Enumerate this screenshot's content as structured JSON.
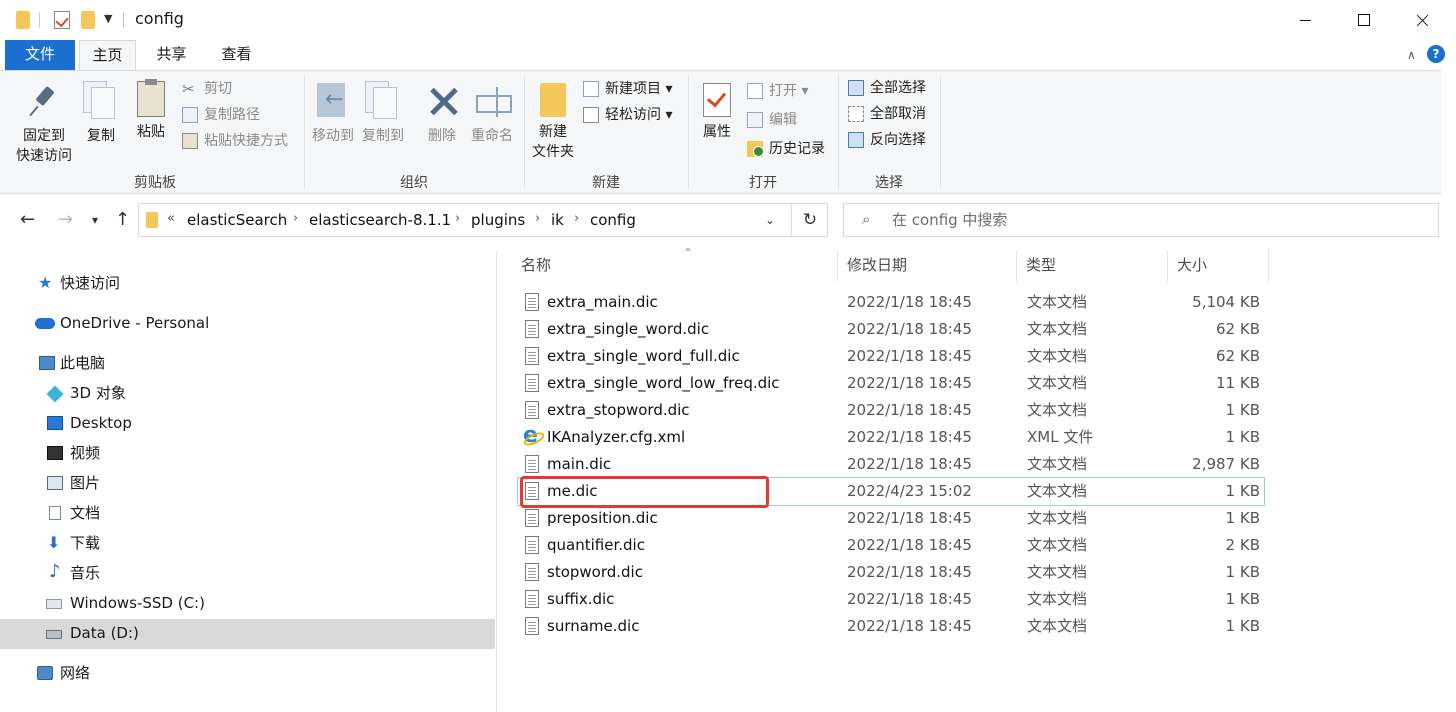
{
  "window": {
    "title": "config"
  },
  "ribbon_tabs": {
    "file": "文件",
    "home": "主页",
    "share": "共享",
    "view": "查看"
  },
  "ribbon": {
    "clipboard": {
      "label": "剪贴板",
      "pin": [
        "固定到",
        "快速访问"
      ],
      "copy": "复制",
      "paste": "粘贴",
      "cut": "剪切",
      "copy_path": "复制路径",
      "paste_shortcut": "粘贴快捷方式"
    },
    "organize": {
      "label": "组织",
      "move_to": "移动到",
      "copy_to": "复制到",
      "delete": "删除",
      "rename": "重命名"
    },
    "new": {
      "label": "新建",
      "new_folder": [
        "新建",
        "文件夹"
      ],
      "new_item": "新建项目",
      "easy_access": "轻松访问"
    },
    "open": {
      "label": "打开",
      "properties": "属性",
      "open": "打开",
      "edit": "编辑",
      "history": "历史记录"
    },
    "select": {
      "label": "选择",
      "select_all": "全部选择",
      "select_none": "全部取消",
      "invert": "反向选择"
    }
  },
  "address": {
    "overflow": "«",
    "crumbs": [
      "elasticSearch",
      "elasticsearch-8.1.1",
      "plugins",
      "ik",
      "config"
    ],
    "sep": "›"
  },
  "search": {
    "placeholder": "在 config 中搜索"
  },
  "nav": {
    "quick_access": "快速访问",
    "onedrive": "OneDrive - Personal",
    "this_pc": "此电脑",
    "objects3d": "3D 对象",
    "desktop": "Desktop",
    "videos": "视频",
    "pictures": "图片",
    "documents": "文档",
    "downloads": "下载",
    "music": "音乐",
    "drive_c": "Windows-SSD (C:)",
    "drive_d": "Data (D:)",
    "network": "网络"
  },
  "columns": {
    "name": "名称",
    "date": "修改日期",
    "type": "类型",
    "size": "大小"
  },
  "files": [
    {
      "name": "extra_main.dic",
      "date": "2022/1/18 18:45",
      "type": "文本文档",
      "size": "5,104 KB",
      "icon": "text-file-icon"
    },
    {
      "name": "extra_single_word.dic",
      "date": "2022/1/18 18:45",
      "type": "文本文档",
      "size": "62 KB",
      "icon": "text-file-icon"
    },
    {
      "name": "extra_single_word_full.dic",
      "date": "2022/1/18 18:45",
      "type": "文本文档",
      "size": "62 KB",
      "icon": "text-file-icon"
    },
    {
      "name": "extra_single_word_low_freq.dic",
      "date": "2022/1/18 18:45",
      "type": "文本文档",
      "size": "11 KB",
      "icon": "text-file-icon"
    },
    {
      "name": "extra_stopword.dic",
      "date": "2022/1/18 18:45",
      "type": "文本文档",
      "size": "1 KB",
      "icon": "text-file-icon"
    },
    {
      "name": "IKAnalyzer.cfg.xml",
      "date": "2022/1/18 18:45",
      "type": "XML 文件",
      "size": "1 KB",
      "icon": "ie-xml-icon"
    },
    {
      "name": "main.dic",
      "date": "2022/1/18 18:45",
      "type": "文本文档",
      "size": "2,987 KB",
      "icon": "text-file-icon"
    },
    {
      "name": "me.dic",
      "date": "2022/4/23 15:02",
      "type": "文本文档",
      "size": "1 KB",
      "icon": "text-file-icon",
      "selected": true
    },
    {
      "name": "preposition.dic",
      "date": "2022/1/18 18:45",
      "type": "文本文档",
      "size": "1 KB",
      "icon": "text-file-icon"
    },
    {
      "name": "quantifier.dic",
      "date": "2022/1/18 18:45",
      "type": "文本文档",
      "size": "2 KB",
      "icon": "text-file-icon"
    },
    {
      "name": "stopword.dic",
      "date": "2022/1/18 18:45",
      "type": "文本文档",
      "size": "1 KB",
      "icon": "text-file-icon"
    },
    {
      "name": "suffix.dic",
      "date": "2022/1/18 18:45",
      "type": "文本文档",
      "size": "1 KB",
      "icon": "text-file-icon"
    },
    {
      "name": "surname.dic",
      "date": "2022/1/18 18:45",
      "type": "文本文档",
      "size": "1 KB",
      "icon": "text-file-icon"
    }
  ],
  "colors": {
    "accent": "#1a6fd1",
    "highlight": "#e53935",
    "selected_nav": "#d9d9d9"
  }
}
